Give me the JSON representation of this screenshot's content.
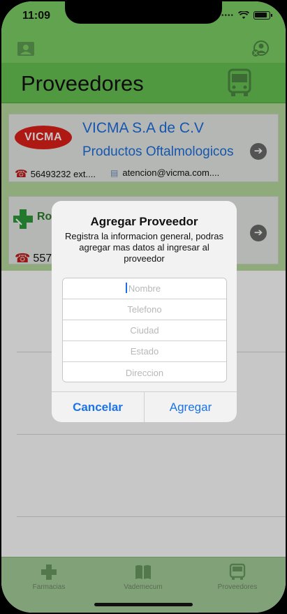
{
  "status_bar": {
    "time": "11:09"
  },
  "header": {
    "title": "Proveedores"
  },
  "providers": [
    {
      "name": "VICMA S.A de C.V",
      "category": "Productos Oftalmologicos",
      "logo_text": "VICMA",
      "phone": "56493232 ext....",
      "email": "atencion@vicma.com...."
    },
    {
      "name_partial": "Ro",
      "phone_partial": "557"
    }
  ],
  "dialog": {
    "title": "Agregar Proveedor",
    "message": "Registra la informacion general, podras agregar mas datos al ingresar al proveedor",
    "fields": {
      "nombre": "Nombre",
      "telefono": "Telefono",
      "ciudad": "Ciudad",
      "estado": "Estado",
      "direccion": "Direccion"
    },
    "cancel_label": "Cancelar",
    "add_label": "Agregar"
  },
  "tabbar": {
    "items": [
      {
        "label": "Farmacias",
        "icon": "pharmacy-cross-icon"
      },
      {
        "label": "Vademecum",
        "icon": "book-icon"
      },
      {
        "label": "Proveedores",
        "icon": "bus-icon"
      }
    ]
  },
  "colors": {
    "top_bar": "#7ed167",
    "title_bar": "#67c552",
    "link_blue": "#1c6fe0",
    "tab_bar": "#a6d09b"
  }
}
